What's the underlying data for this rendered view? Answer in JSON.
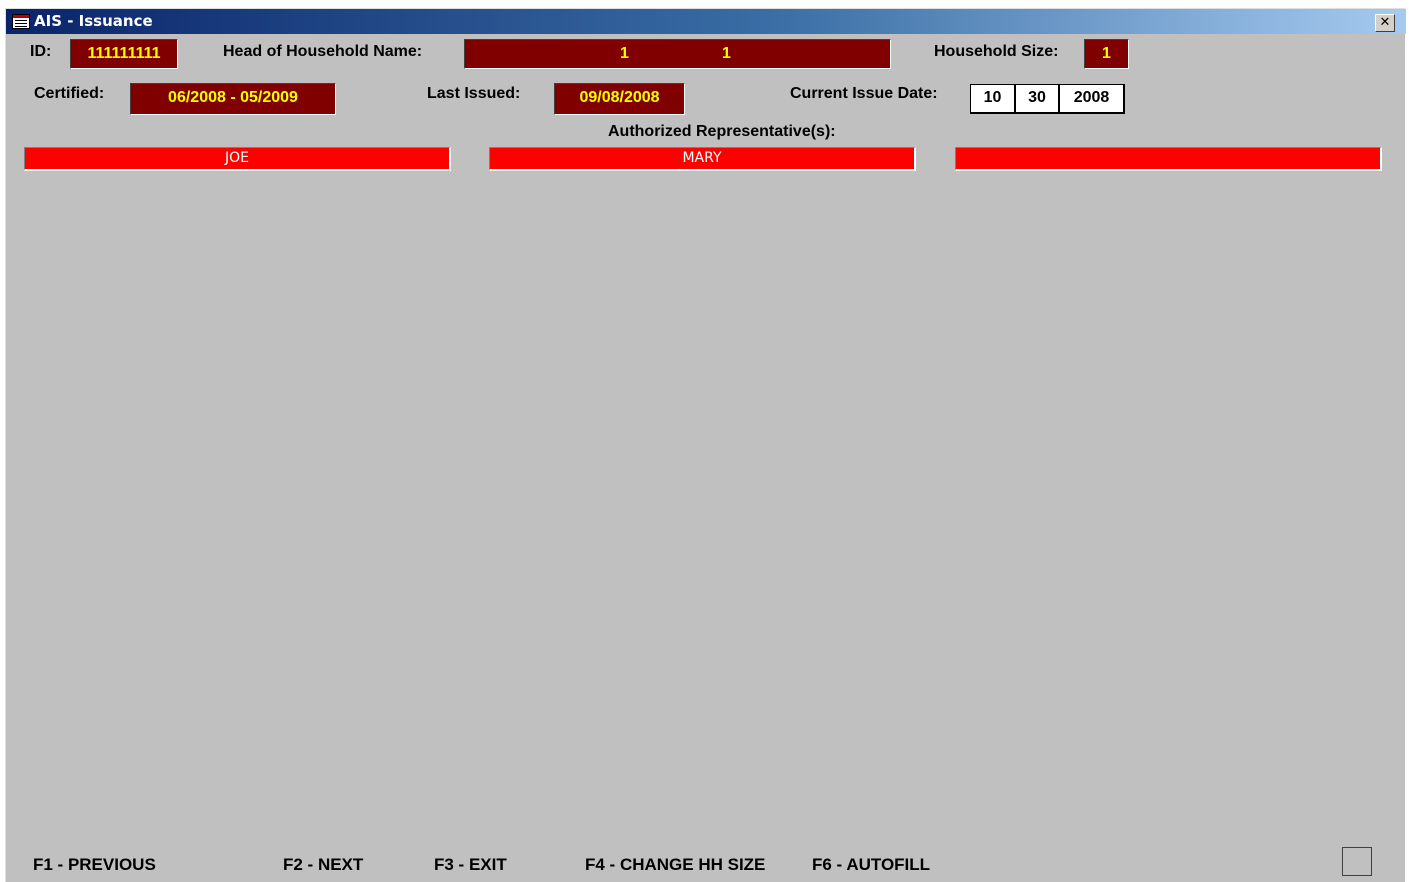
{
  "window": {
    "title": "AIS - Issuance",
    "close_label": "✕"
  },
  "header": {
    "id_label": "ID:",
    "id_value": "111111111",
    "hoh_label": "Head of Household Name:",
    "hoh_first": "1",
    "hoh_last": "1",
    "hh_size_label": "Household Size:",
    "hh_size_value": "1",
    "certified_label": "Certified:",
    "certified_value": "06/2008 - 05/2009",
    "last_issued_label": "Last Issued:",
    "last_issued_value": "09/08/2008",
    "current_issue_label": "Current Issue Date:",
    "current_issue_month": "10",
    "current_issue_day": "30",
    "current_issue_year": "2008"
  },
  "representatives": {
    "label": "Authorized Representative(s):",
    "items": [
      "JOE",
      "MARY",
      ""
    ]
  },
  "function_keys": [
    "F1 - PREVIOUS",
    "F2 - NEXT",
    "F3 - EXIT",
    "F4 - CHANGE HH SIZE",
    "F6 - AUTOFILL"
  ],
  "colors": {
    "field_bg": "#800000",
    "field_text": "#ffff00",
    "rep_bg": "#ff0000",
    "window_bg": "#c0c0c0",
    "titlebar_start": "#0a246a"
  }
}
